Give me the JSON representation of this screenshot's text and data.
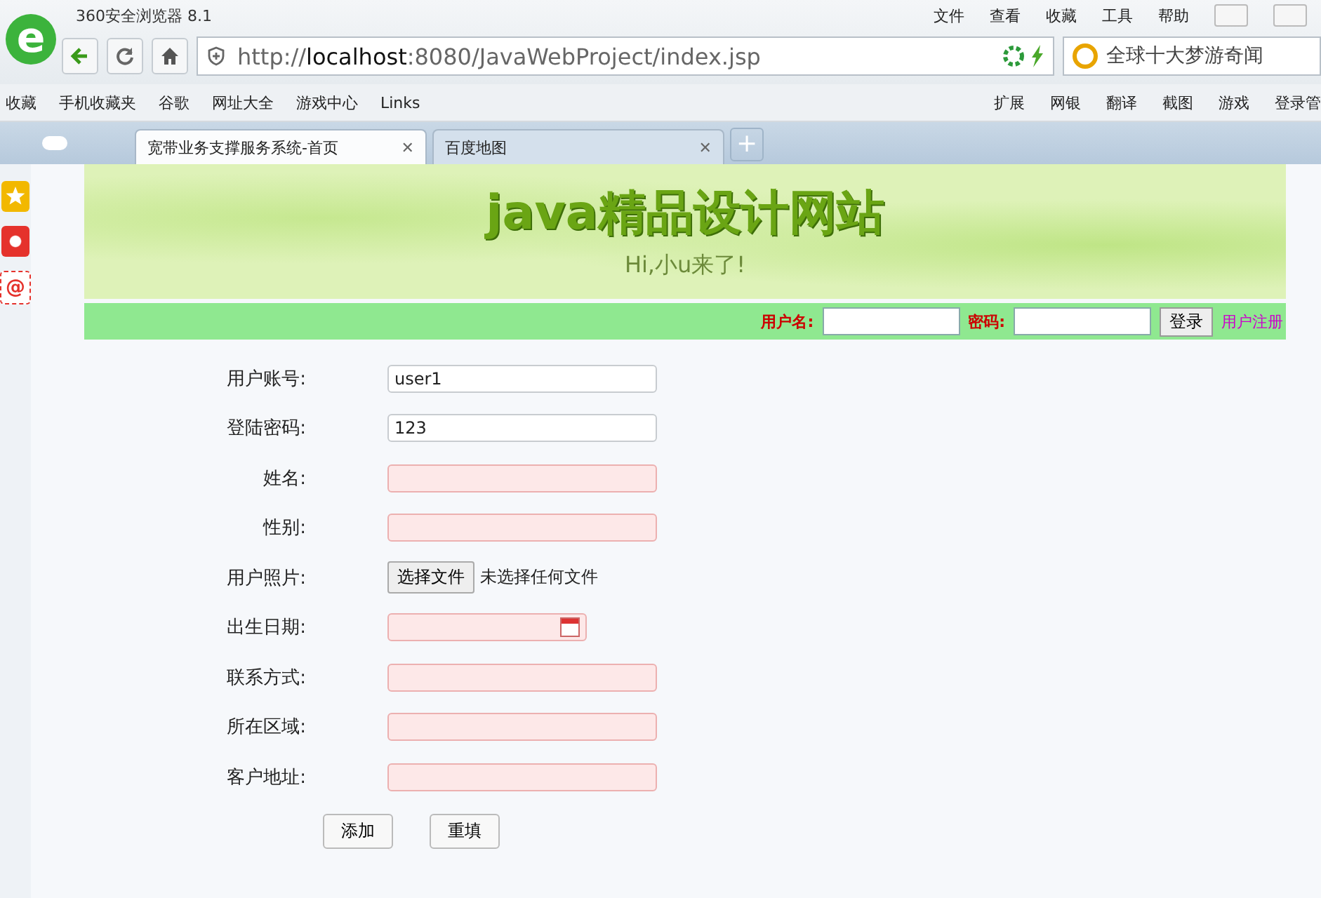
{
  "window": {
    "title": "360安全浏览器 8.1"
  },
  "logo": "e",
  "menu": [
    "文件",
    "查看",
    "收藏",
    "工具",
    "帮助"
  ],
  "address": {
    "value": "http://**localhost**:8080/JavaWebProject/index.jsp"
  },
  "search": {
    "value": "全球十大梦游奇闻"
  },
  "bookmarks_left": [
    "收藏",
    "手机收藏夹",
    "谷歌",
    "网址大全",
    "游戏中心",
    "Links"
  ],
  "bookmarks_right": [
    "扩展",
    "网银",
    "翻译",
    "截图",
    "游戏",
    "登录管"
  ],
  "tabs": [
    {
      "label": "宽带业务支撑服务系统-首页",
      "close": "✕",
      "selected": true
    },
    {
      "label": "百度地图",
      "close": "✕",
      "selected": false
    }
  ],
  "new_tab": "+",
  "sidebar": {
    "mail_icon": "@"
  },
  "banner": {
    "title": "java精品设计网站",
    "subtitle": "Hi,小u来了!"
  },
  "login": {
    "username_label": "用户名:",
    "password_label": "密码:",
    "button": "登录",
    "register": "用户注册"
  },
  "form": {
    "fields": [
      {
        "label": "用户账号:",
        "kind": "text",
        "value": "user1",
        "invalid": false
      },
      {
        "label": "登陆密码:",
        "kind": "text",
        "value": "123",
        "invalid": false
      },
      {
        "label": "姓名:",
        "kind": "text",
        "invalid": true
      },
      {
        "label": "性别:",
        "kind": "text",
        "invalid": true
      },
      {
        "label": "用户照片:",
        "kind": "file",
        "button": "选择文件",
        "status": "未选择任何文件"
      },
      {
        "label": "出生日期:",
        "kind": "date",
        "invalid": true
      },
      {
        "label": "联系方式:",
        "kind": "text",
        "invalid": true
      },
      {
        "label": "所在区域:",
        "kind": "text",
        "invalid": true
      },
      {
        "label": "客户地址:",
        "kind": "text",
        "invalid": true
      }
    ],
    "buttons": [
      "添加",
      "重填"
    ]
  }
}
